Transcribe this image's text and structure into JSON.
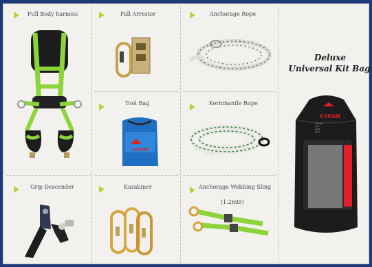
{
  "products": [
    {
      "id": "harness",
      "title": "Full Body harness"
    },
    {
      "id": "arrester",
      "title": "Fall Arrester"
    },
    {
      "id": "anchor-rope",
      "title": "Anchorage Rope"
    },
    {
      "id": "tool-bag",
      "title": "Tool Bag"
    },
    {
      "id": "kernmantle",
      "title": "Kernmantle Rope"
    },
    {
      "id": "descender",
      "title": "Grip Descender"
    },
    {
      "id": "karabiner",
      "title": "Karabiner"
    },
    {
      "id": "sling",
      "title": "Anchorage Webbing Sling",
      "subtitle": "(1.2mtr)"
    }
  ],
  "kit_bag": {
    "title_line1": "Deluxe",
    "title_line2": "Universal Kit Bag",
    "brand": "KARAM",
    "tagline": "Securing your world better"
  },
  "tool_bag_brand": "KARAM",
  "colors": {
    "accent": "#b7d23a",
    "border": "#1d3a7a",
    "green": "#7ed321",
    "bag_red": "#e0202a"
  }
}
